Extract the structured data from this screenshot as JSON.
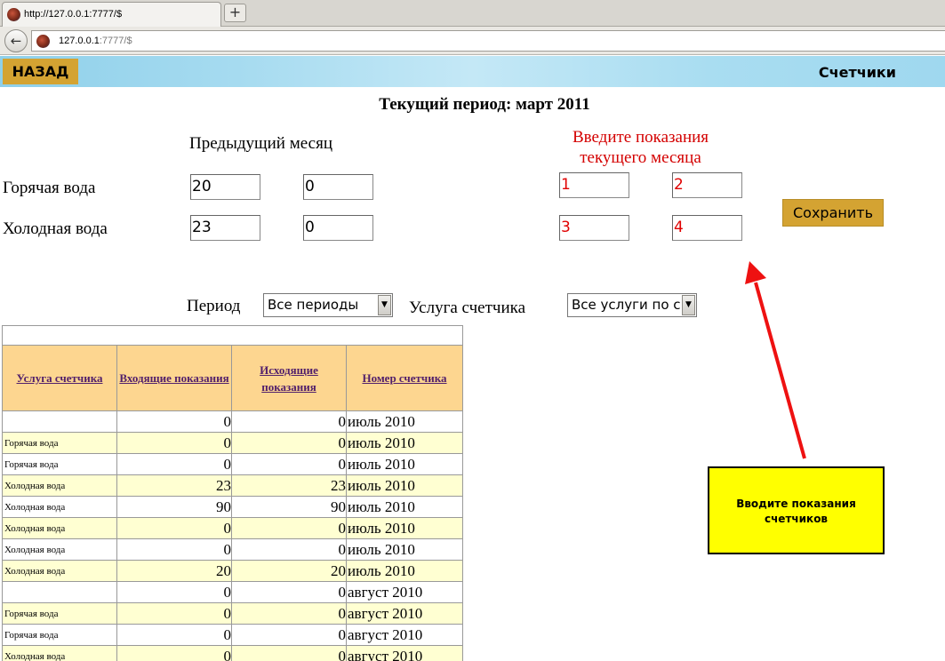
{
  "browser": {
    "tab_title": "http://127.0.0.1:7777/$",
    "new_tab_label": "+",
    "back_label": "←",
    "url_host": "127.0.0.1",
    "url_rest": ":7777/$"
  },
  "header": {
    "back_button": "НАЗАД",
    "title": "Счетчики"
  },
  "period_title": "Текущий период: март 2011",
  "previous_month_label": "Предыдущий месяц",
  "enter_readings": {
    "line1": "Введите показания",
    "line2": "текущего месяца"
  },
  "meters": [
    {
      "label": "Горячая вода",
      "prev_in": "20",
      "prev_out": "0",
      "cur_in": "1",
      "cur_out": "2"
    },
    {
      "label": "Холодная вода",
      "prev_in": "23",
      "prev_out": "0",
      "cur_in": "3",
      "cur_out": "4"
    }
  ],
  "save_button": "Сохранить",
  "filters": {
    "period_label": "Период",
    "period_value": "Все периоды",
    "service_label": "Услуга счетчика",
    "service_value": "Все услуги по с"
  },
  "table": {
    "columns": [
      "Услуга счетчика",
      "Входящие показания",
      "Исходящие показания",
      "Номер счетчика"
    ],
    "rows": [
      {
        "service": "",
        "in": "0",
        "out": "0",
        "period": "июль 2010"
      },
      {
        "service": "Горячая вода",
        "in": "0",
        "out": "0",
        "period": "июль 2010"
      },
      {
        "service": "Горячая вода",
        "in": "0",
        "out": "0",
        "period": "июль 2010"
      },
      {
        "service": "Холодная вода",
        "in": "23",
        "out": "23",
        "period": "июль 2010"
      },
      {
        "service": "Холодная вода",
        "in": "90",
        "out": "90",
        "period": "июль 2010"
      },
      {
        "service": "Холодная вода",
        "in": "0",
        "out": "0",
        "period": "июль 2010"
      },
      {
        "service": "Холодная вода",
        "in": "0",
        "out": "0",
        "period": "июль 2010"
      },
      {
        "service": "Холодная вода",
        "in": "20",
        "out": "20",
        "period": "июль 2010"
      },
      {
        "service": "",
        "in": "0",
        "out": "0",
        "period": "август 2010"
      },
      {
        "service": "Горячая вода",
        "in": "0",
        "out": "0",
        "period": "август 2010"
      },
      {
        "service": "Горячая вода",
        "in": "0",
        "out": "0",
        "period": "август 2010"
      },
      {
        "service": "Холодная вода",
        "in": "0",
        "out": "0",
        "period": "август 2010"
      }
    ]
  },
  "callout": {
    "line1": "Вводите показания",
    "line2": "счетчиков"
  },
  "colors": {
    "accent_button": "#d4a332",
    "header_gradient": "#a6dbf0",
    "table_header": "#fdd690",
    "row_alt": "#ffffd2",
    "annotation_red": "#ee1111",
    "callout_yellow": "#ffff00"
  }
}
